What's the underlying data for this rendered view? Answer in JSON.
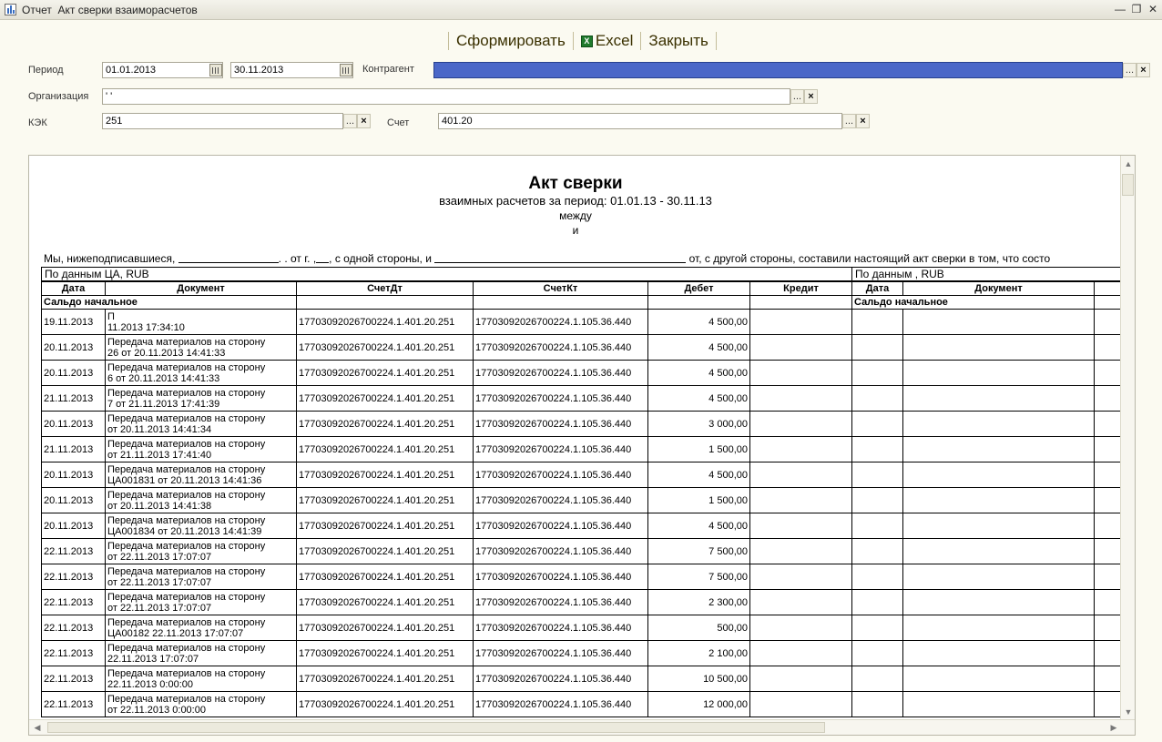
{
  "window": {
    "title": "Отчет  Акт сверки взаиморасчетов"
  },
  "toolbar": {
    "generate": "Сформировать",
    "excel": "Excel",
    "close": "Закрыть"
  },
  "form": {
    "period_label": "Период",
    "date_from": "01.01.2013",
    "date_to": "30.11.2013",
    "contractor_label": "Контрагент",
    "contractor_value": "",
    "org_label": "Организация",
    "org_value": "' '",
    "kek_label": "КЭК",
    "kek_value": "251",
    "account_label": "Счет",
    "account_value": "401.20",
    "select_btn": "...",
    "clear_btn": "×"
  },
  "report": {
    "title": "Акт сверки",
    "subtitle": "взаимных расчетов за период: 01.01.13 - 30.11.13",
    "between": "между",
    "and": "и",
    "intro_a": "Мы, нижеподписавшиеся,",
    "intro_b": ". . от г. ,",
    "intro_c": ", с одной стороны, и",
    "intro_d": "от",
    "intro_e": ", с другой стороны, составили настоящий акт сверки в том, что состо",
    "left_caption": "По данным ЦА, RUB",
    "right_caption": "По данным  , RUB",
    "headers": {
      "date": "Дата",
      "document": "Документ",
      "dt": "СчетДт",
      "kt": "СчетКт",
      "debit": "Дебет",
      "credit": "Кредит",
      "date2": "Дата",
      "document2": "Документ"
    },
    "saldo": "Сальдо начальное",
    "rows": [
      {
        "date": "19.11.2013",
        "doc1": "П",
        "doc2": "11.2013 17:34:10",
        "dt": "17703092026700224.1.401.20.251",
        "kt": "17703092026700224.1.105.36.440",
        "debit": "4 500,00"
      },
      {
        "date": "20.11.2013",
        "doc1": "Передача материалов на сторону",
        "doc2": "26 от 20.11.2013 14:41:33",
        "dt": "17703092026700224.1.401.20.251",
        "kt": "17703092026700224.1.105.36.440",
        "debit": "4 500,00"
      },
      {
        "date": "20.11.2013",
        "doc1": "Передача материалов на сторону",
        "doc2": "6 от 20.11.2013 14:41:33",
        "dt": "17703092026700224.1.401.20.251",
        "kt": "17703092026700224.1.105.36.440",
        "debit": "4 500,00"
      },
      {
        "date": "21.11.2013",
        "doc1": "Передача материалов на сторону",
        "doc2": "7 от 21.11.2013 17:41:39",
        "dt": "17703092026700224.1.401.20.251",
        "kt": "17703092026700224.1.105.36.440",
        "debit": "4 500,00"
      },
      {
        "date": "20.11.2013",
        "doc1": "Передача материалов на сторону",
        "doc2": "от 20.11.2013 14:41:34",
        "dt": "17703092026700224.1.401.20.251",
        "kt": "17703092026700224.1.105.36.440",
        "debit": "3 000,00"
      },
      {
        "date": "21.11.2013",
        "doc1": "Передача материалов на сторону",
        "doc2": "от 21.11.2013 17:41:40",
        "dt": "17703092026700224.1.401.20.251",
        "kt": "17703092026700224.1.105.36.440",
        "debit": "1 500,00"
      },
      {
        "date": "20.11.2013",
        "doc1": "Передача материалов на сторону",
        "doc2": "ЦА001831 от 20.11.2013 14:41:36",
        "dt": "17703092026700224.1.401.20.251",
        "kt": "17703092026700224.1.105.36.440",
        "debit": "4 500,00"
      },
      {
        "date": "20.11.2013",
        "doc1": "Передача материалов на сторону",
        "doc2": "от 20.11.2013 14:41:38",
        "dt": "17703092026700224.1.401.20.251",
        "kt": "17703092026700224.1.105.36.440",
        "debit": "1 500,00"
      },
      {
        "date": "20.11.2013",
        "doc1": "Передача материалов на сторону",
        "doc2": "ЦА001834 от 20.11.2013 14:41:39",
        "dt": "17703092026700224.1.401.20.251",
        "kt": "17703092026700224.1.105.36.440",
        "debit": "4 500,00"
      },
      {
        "date": "22.11.2013",
        "doc1": "Передача материалов на сторону",
        "doc2": "от 22.11.2013 17:07:07",
        "dt": "17703092026700224.1.401.20.251",
        "kt": "17703092026700224.1.105.36.440",
        "debit": "7 500,00"
      },
      {
        "date": "22.11.2013",
        "doc1": "Передача материалов на сторону",
        "doc2": "от 22.11.2013 17:07:07",
        "dt": "17703092026700224.1.401.20.251",
        "kt": "17703092026700224.1.105.36.440",
        "debit": "7 500,00"
      },
      {
        "date": "22.11.2013",
        "doc1": "Передача материалов на сторону",
        "doc2": "от 22.11.2013 17:07:07",
        "dt": "17703092026700224.1.401.20.251",
        "kt": "17703092026700224.1.105.36.440",
        "debit": "2 300,00"
      },
      {
        "date": "22.11.2013",
        "doc1": "Передача материалов на сторону",
        "doc2": "ЦА00182 22.11.2013 17:07:07",
        "dt": "17703092026700224.1.401.20.251",
        "kt": "17703092026700224.1.105.36.440",
        "debit": "500,00"
      },
      {
        "date": "22.11.2013",
        "doc1": "Передача материалов на сторону",
        "doc2": "22.11.2013 17:07:07",
        "dt": "17703092026700224.1.401.20.251",
        "kt": "17703092026700224.1.105.36.440",
        "debit": "2 100,00"
      },
      {
        "date": "22.11.2013",
        "doc1": "Передача материалов на сторону",
        "doc2": "22.11.2013 0:00:00",
        "dt": "17703092026700224.1.401.20.251",
        "kt": "17703092026700224.1.105.36.440",
        "debit": "10 500,00"
      },
      {
        "date": "22.11.2013",
        "doc1": "Передача материалов на сторону",
        "doc2": "от 22.11.2013 0:00:00",
        "dt": "17703092026700224.1.401.20.251",
        "kt": "17703092026700224.1.105.36.440",
        "debit": "12 000,00"
      }
    ]
  },
  "colors": {
    "contractor_fill": "#4a67c8",
    "window_bg": "#fbfaf1",
    "toolbar_text": "#3a3000"
  }
}
